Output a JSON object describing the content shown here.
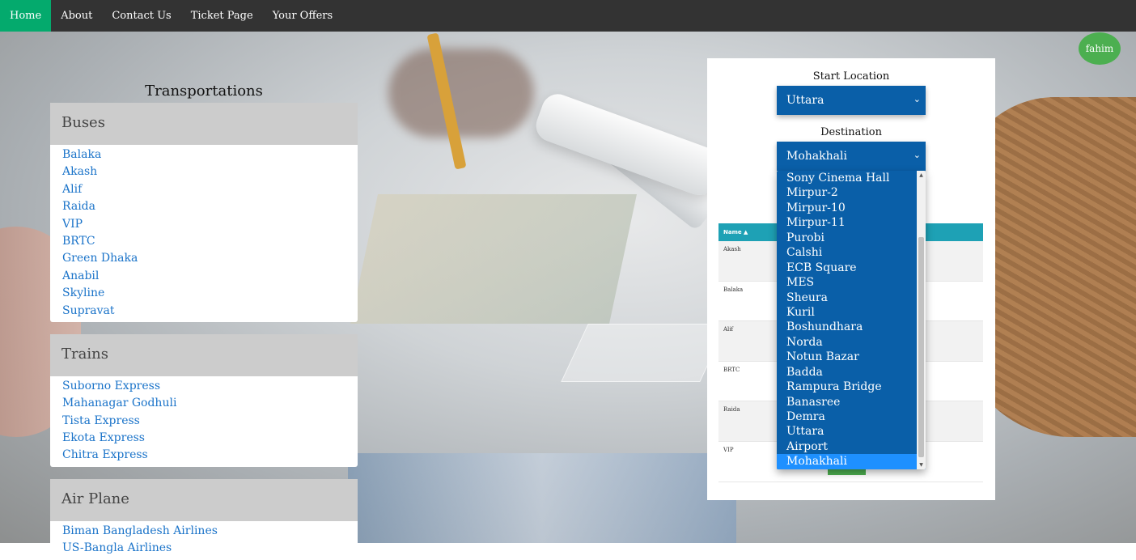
{
  "navbar": {
    "items": [
      {
        "label": "Home",
        "active": true
      },
      {
        "label": "About"
      },
      {
        "label": "Contact Us"
      },
      {
        "label": "Ticket Page"
      },
      {
        "label": "Your Offers"
      }
    ]
  },
  "user": {
    "name": "fahim"
  },
  "transportations": {
    "title": "Transportations",
    "categories": [
      {
        "name": "Buses",
        "items": [
          "Balaka",
          "Akash",
          "Alif",
          "Raida",
          "VIP",
          "BRTC",
          "Green Dhaka",
          "Anabil",
          "Skyline",
          "Supravat"
        ]
      },
      {
        "name": "Trains",
        "items": [
          "Suborno Express",
          "Mahanagar Godhuli",
          "Tista Express",
          "Ekota Express",
          "Chitra Express"
        ]
      },
      {
        "name": "Air Plane",
        "items": [
          "Biman Bangladesh Airlines",
          "US-Bangla Airlines"
        ]
      }
    ]
  },
  "search": {
    "start_label": "Start Location",
    "start_value": "Uttara",
    "destination_label": "Destination",
    "destination_value": "Mohakhali",
    "destination_options": [
      "Sony Cinema Hall",
      "Mirpur-2",
      "Mirpur-10",
      "Mirpur-11",
      "Purobi",
      "Calshi",
      "ECB Square",
      "MES",
      "Sheura",
      "Kuril",
      "Boshundhara",
      "Norda",
      "Notun Bazar",
      "Badda",
      "Rampura Bridge",
      "Banasree",
      "Demra",
      "Uttara",
      "Airport",
      "Mohakhali"
    ]
  },
  "results": {
    "header": "Name ▲",
    "rows": [
      "Akash",
      "Balaka",
      "Alif",
      "BRTC",
      "Raida",
      "VIP"
    ]
  },
  "colors": {
    "nav_active": "#04AA6D",
    "select_bg": "#0a5fa8",
    "option_highlight": "#1e90ff",
    "table_header": "#1ea1b5",
    "link": "#1a73c9",
    "avatar": "#4CAF50"
  }
}
